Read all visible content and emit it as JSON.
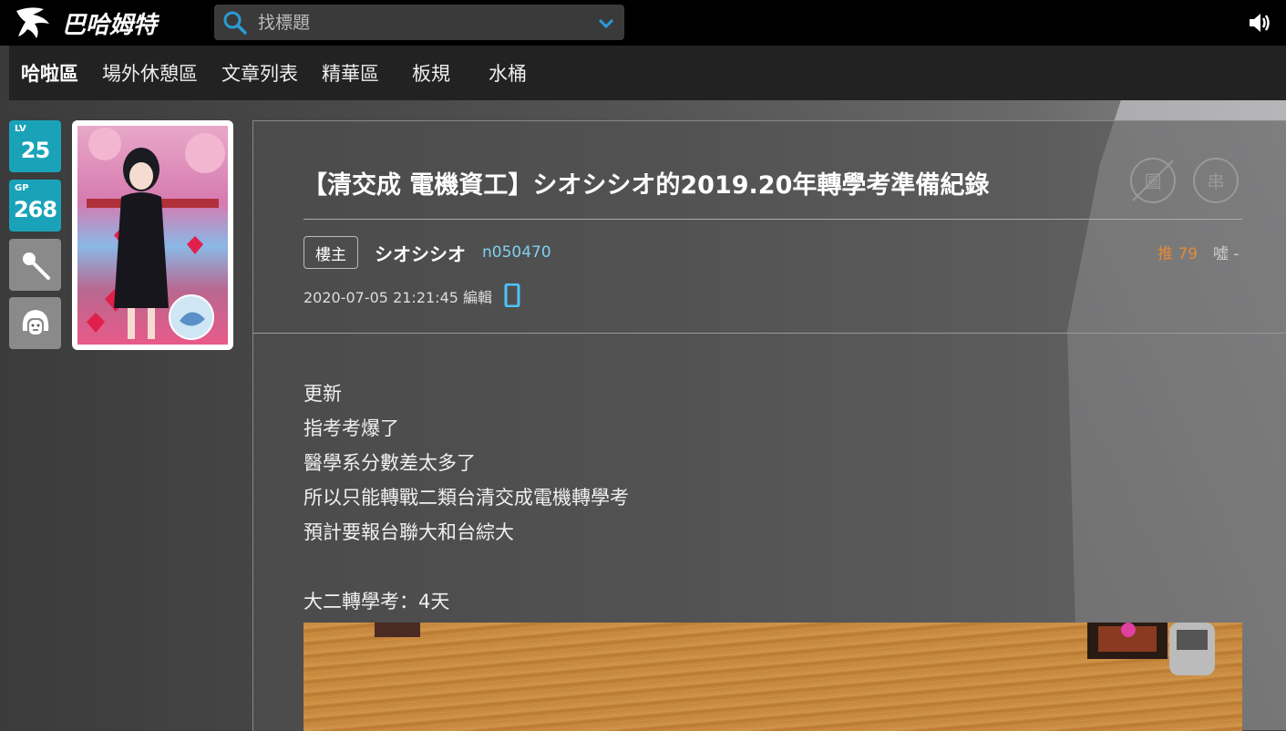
{
  "header": {
    "logo_text": "巴哈姆特",
    "search_placeholder": "找標題"
  },
  "nav": {
    "items": [
      "哈啦區",
      "場外休憩區",
      "文章列表",
      "精華區",
      "板規",
      "水桶"
    ]
  },
  "user_badges": {
    "lv_label": "LV",
    "lv_value": "25",
    "gp_label": "GP",
    "gp_value": "268"
  },
  "post": {
    "title": "【清交成 電機資工】シオシシオ的2019.20年轉學考準備紀錄",
    "icon_image_label": "圖",
    "icon_string_label": "串",
    "owner_label": "樓主",
    "username": "シオシシオ",
    "user_id": "n050470",
    "push_text": "推 79",
    "boo_text": "噓 -",
    "timestamp": "2020-07-05 21:21:45 編輯",
    "lines": [
      "更新",
      "指考考爆了",
      "醫學系分數差太多了",
      "所以只能轉戰二類台清交成電機轉學考",
      "預計要報台聯大和台綜大"
    ],
    "countdown": "大二轉學考：4天"
  },
  "colors": {
    "accent_teal": "#1aa3b8",
    "push_orange": "#e58a3a",
    "user_id_blue": "#7fd0ef",
    "search_icon_blue": "#2a9bd6"
  }
}
